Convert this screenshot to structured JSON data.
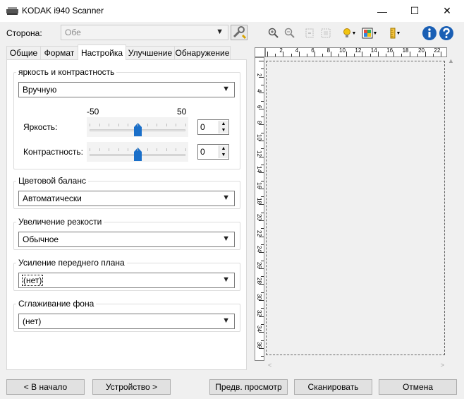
{
  "window": {
    "title": "KODAK i940 Scanner",
    "min": "—",
    "max": "☐",
    "close": "✕"
  },
  "side": {
    "label": "Сторона:",
    "value": "Обе"
  },
  "tabs": [
    "Общие",
    "Формат",
    "Настройка",
    "Улучшение",
    "Обнаружение"
  ],
  "active_tab": 2,
  "brightness_group": {
    "title": "яркость и контрастность",
    "mode": "Вручную",
    "scale_min": "-50",
    "scale_max": "50",
    "brightness_label": "Яркость:",
    "brightness_value": "0",
    "brightness_level": 0,
    "contrast_label": "Контрастность:",
    "contrast_value": "0",
    "contrast_level": 0
  },
  "color_balance": {
    "title": "Цветовой баланс",
    "value": "Автоматически"
  },
  "sharpening": {
    "title": "Увеличение резкости",
    "value": "Обычное"
  },
  "foreground": {
    "title": "Усиление переднего плана",
    "value": "(нет)"
  },
  "background": {
    "title": "Сглаживание фона",
    "value": "(нет)"
  },
  "ruler": {
    "top_labels": [
      "2",
      "4",
      "6",
      "8",
      "10",
      "12",
      "14",
      "16",
      "18",
      "20",
      "22"
    ],
    "left_labels": [
      "2",
      "4",
      "6",
      "8",
      "10",
      "12",
      "14",
      "16",
      "18",
      "20",
      "22",
      "24",
      "26",
      "28",
      "30",
      "32",
      "34",
      "36"
    ]
  },
  "buttons": {
    "home": "< В начало",
    "device": "Устройство >",
    "preview": "Предв. просмотр",
    "scan": "Сканировать",
    "cancel": "Отмена"
  },
  "colors": {
    "accent": "#1a6fc9",
    "thumb": "#1a6fc9"
  }
}
